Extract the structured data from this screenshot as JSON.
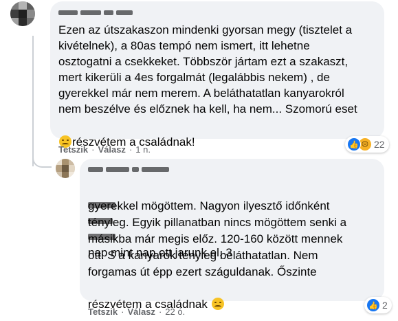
{
  "comment1": {
    "text_lines": [
      "Ezen az útszakaszon mindenki gyorsan megy (tisztelet a",
      "kivételnek), a 80as tempó nem ismert, itt lehetne",
      "osztogatni a csekkeket. Többször jártam ezt a szakaszt,",
      "mert kikerüli a 4es forgalmát (legalábbis nekem) , de",
      "gyerekkel már nem merem. A beláthatatlan kanyarokról",
      "nem beszélve és előznek ha kell, ha nem... Szomorú eset"
    ],
    "last_line": "részvétem a családnak!",
    "actions": {
      "like": "Tetszik",
      "reply": "Válasz",
      "time": "1 n."
    },
    "reaction_count": "22",
    "reaction_icons": [
      "like-icon",
      "sad-icon"
    ]
  },
  "reply1": {
    "first_line": "nap mint nap ott jarunk el. 3",
    "text_lines": [
      "gyerekkel mögöttem. Nagyon ilyesztő időnként",
      "tényleg. Egyik pillanatban nincs mögöttem senki a",
      "másikba már megis előz. 120-160 között mennek",
      "ott. S a kanyarok tényleg beláthatatlan. Nem",
      "forgamas út épp ezert száguldanak. Őszinte"
    ],
    "last_line": "részvétem a családnak",
    "actions": {
      "like": "Tetszik",
      "reply": "Válasz",
      "time": "22 ó."
    },
    "reaction_count": "2",
    "reaction_icons": [
      "like-icon"
    ]
  },
  "dot": "·",
  "colors": {
    "bubble": "#f0f2f5",
    "meta": "#65676b",
    "like": "#1877f2",
    "sad": "#f7b125"
  }
}
